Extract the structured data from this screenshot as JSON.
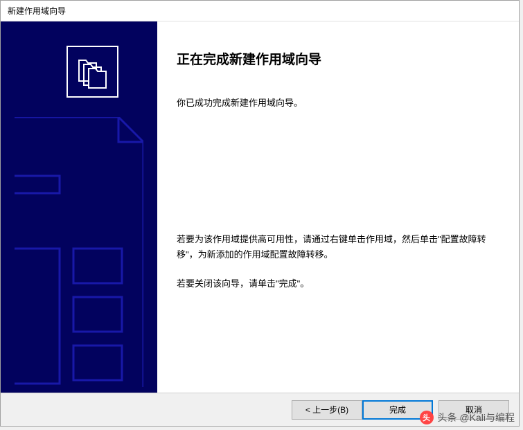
{
  "dialog": {
    "title": "新建作用域向导"
  },
  "content": {
    "heading": "正在完成新建作用域向导",
    "success_text": "你已成功完成新建作用域向导。",
    "availability_text": "若要为该作用域提供高可用性，请通过右键单击作用域，然后单击\"配置故障转移\"，为新添加的作用域配置故障转移。",
    "close_text": "若要关闭该向导，请单击\"完成\"。"
  },
  "buttons": {
    "back": "< 上一步(B)",
    "finish": "完成",
    "cancel": "取消"
  },
  "watermark": {
    "text": "头条 @Kali与编程"
  }
}
